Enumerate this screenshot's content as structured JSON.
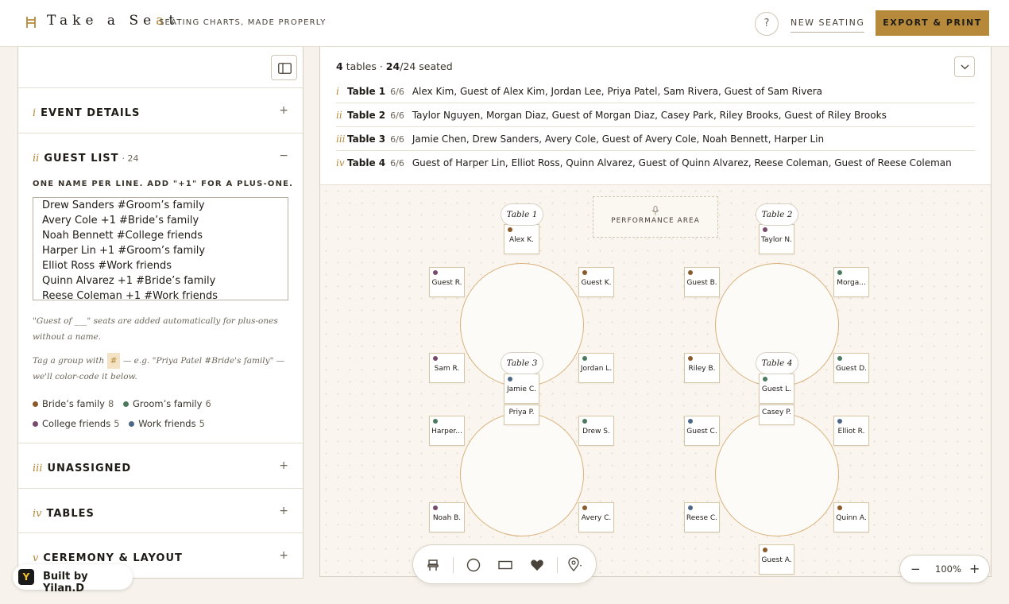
{
  "header": {
    "logo_text_main": "Take a Se",
    "logo_text_accent": "a",
    "logo_text_end": "t",
    "tagline": "SEATING CHARTS, MADE PROPERLY",
    "help_label": "?",
    "new_seating_label": "NEW SEATING",
    "export_label": "EXPORT & PRINT"
  },
  "colors": {
    "accent": "#b68a3a",
    "brides_family": "#8a5a2b",
    "grooms_family": "#4b7a5e",
    "college_friends": "#7a4a6e",
    "work_friends": "#4d6786"
  },
  "sidebar": {
    "sections": [
      {
        "roman": "i",
        "title": "EVENT DETAILS",
        "toggle": "+"
      },
      {
        "roman": "ii",
        "title": "GUEST LIST",
        "count": "· 24",
        "toggle": "−"
      },
      {
        "roman": "iii",
        "title": "UNASSIGNED",
        "toggle": "+"
      },
      {
        "roman": "iv",
        "title": "TABLES",
        "toggle": "+"
      },
      {
        "roman": "v",
        "title": "CEREMONY & LAYOUT",
        "toggle": "+"
      }
    ],
    "guest_list_hint": "ONE NAME PER LINE. ADD \"+1\" FOR A PLUS-ONE.",
    "guest_textarea": "Drew Sanders #Groom’s family\nAvery Cole +1 #Bride’s family\nNoah Bennett #College friends\nHarper Lin +1 #Groom’s family\nElliot Ross #Work friends\nQuinn Alvarez +1 #Bride’s family\nReese Coleman +1 #Work friends",
    "note_plus_one": "\"Guest of ___\" seats are added automatically for plus-ones without a name.",
    "note_tag_before": "Tag a group with",
    "note_tag_chip": "#",
    "note_tag_after": "— e.g. \"Priya Patel #Bride's family\" — we'll color-code it below.",
    "groups": [
      {
        "name": "Bride’s family",
        "count": "8",
        "color": "#8a5a2b"
      },
      {
        "name": "Groom’s family",
        "count": "6",
        "color": "#4b7a5e"
      },
      {
        "name": "College friends",
        "count": "5",
        "color": "#7a4a6e"
      },
      {
        "name": "Work friends",
        "count": "5",
        "color": "#4d6786"
      }
    ]
  },
  "badge": {
    "logo": "Y",
    "text": "Built by Yilan.D"
  },
  "summary": {
    "tables_count": "4",
    "tables_word": "tables ·",
    "seated": "24",
    "total": "/24 seated"
  },
  "tables": [
    {
      "roman": "i",
      "name": "Table 1",
      "count": "6/6",
      "guests": "Alex Kim, Guest of Alex Kim, Jordan Lee, Priya Patel, Sam Rivera, Guest of Sam Rivera"
    },
    {
      "roman": "ii",
      "name": "Table 2",
      "count": "6/6",
      "guests": "Taylor Nguyen, Morgan Diaz, Guest of Morgan Diaz, Casey Park, Riley Brooks, Guest of Riley Brooks"
    },
    {
      "roman": "iii",
      "name": "Table 3",
      "count": "6/6",
      "guests": "Jamie Chen, Drew Sanders, Avery Cole, Guest of Avery Cole, Noah Bennett, Harper Lin"
    },
    {
      "roman": "iv",
      "name": "Table 4",
      "count": "6/6",
      "guests": "Guest of Harper Lin, Elliot Ross, Quinn Alvarez, Guest of Quinn Alvarez, Reese Coleman, Guest of Reese Coleman"
    }
  ],
  "floor": {
    "performance_label": "PERFORMANCE AREA",
    "table_labels": [
      "Table 1",
      "Table 2",
      "Table 3",
      "Table 4"
    ],
    "seats": [
      {
        "label": "Alex K.",
        "color": "#8a5a2b"
      },
      {
        "label": "Guest R.",
        "color": "#7a4a6e"
      },
      {
        "label": "Guest K.",
        "color": "#8a5a2b"
      },
      {
        "label": "Sam R.",
        "color": "#7a4a6e"
      },
      {
        "label": "Jordan L.",
        "color": "#4b7a5e"
      },
      {
        "label": "Priya P.",
        "color": "#8a5a2b"
      },
      {
        "label": "Taylor N.",
        "color": "#7a4a6e"
      },
      {
        "label": "Guest B.",
        "color": "#8a5a2b"
      },
      {
        "label": "Morga...",
        "color": "#4b7a5e"
      },
      {
        "label": "Riley B.",
        "color": "#8a5a2b"
      },
      {
        "label": "Guest D.",
        "color": "#4b7a5e"
      },
      {
        "label": "Casey P.",
        "color": "#4d6786"
      },
      {
        "label": "Jamie C.",
        "color": "#4d6786"
      },
      {
        "label": "Harper...",
        "color": "#4b7a5e"
      },
      {
        "label": "Drew S.",
        "color": "#4b7a5e"
      },
      {
        "label": "Noah B.",
        "color": "#7a4a6e"
      },
      {
        "label": "Avery C.",
        "color": "#8a5a2b"
      },
      {
        "label": "Guest L.",
        "color": "#4b7a5e"
      },
      {
        "label": "Guest C.",
        "color": "#4d6786"
      },
      {
        "label": "Elliot R.",
        "color": "#4d6786"
      },
      {
        "label": "Reese C.",
        "color": "#4d6786"
      },
      {
        "label": "Quinn A.",
        "color": "#8a5a2b"
      },
      {
        "label": "Guest A.",
        "color": "#8a5a2b"
      }
    ]
  },
  "zoom": {
    "minus": "−",
    "value": "100%",
    "plus": "+"
  }
}
